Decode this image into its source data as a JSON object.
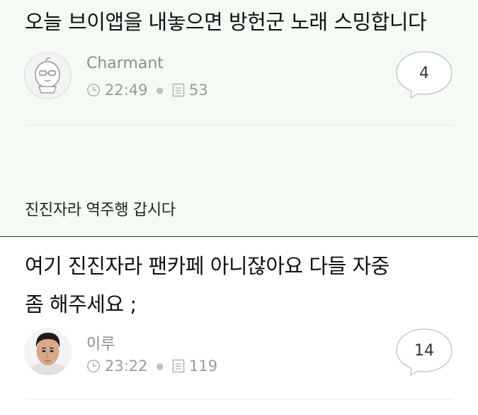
{
  "posts": [
    {
      "title": "오늘 브이앱을 내놓으면 방헌군 노래 스밍합니다",
      "author": "Charmant",
      "time": "22:49",
      "views": "53",
      "comment_count": "4",
      "comment_preview": "진진자라 역주행 갑시다"
    },
    {
      "title_line1": "여기 진진자라 팬카페 아니잖아요 다들 자중",
      "title_line2": "좀 해주세요 ;",
      "author": "이루",
      "time": "23:22",
      "views": "119",
      "comment_count": "14"
    }
  ],
  "icons": {
    "avatar1": "peach-character-icon",
    "avatar2": "man-portrait",
    "time": "clock-icon",
    "views": "document-icon",
    "comments": "speech-bubble-icon"
  },
  "colors": {
    "post1_background": "#f4faf4",
    "meta_gray": "#9a9a9a"
  }
}
